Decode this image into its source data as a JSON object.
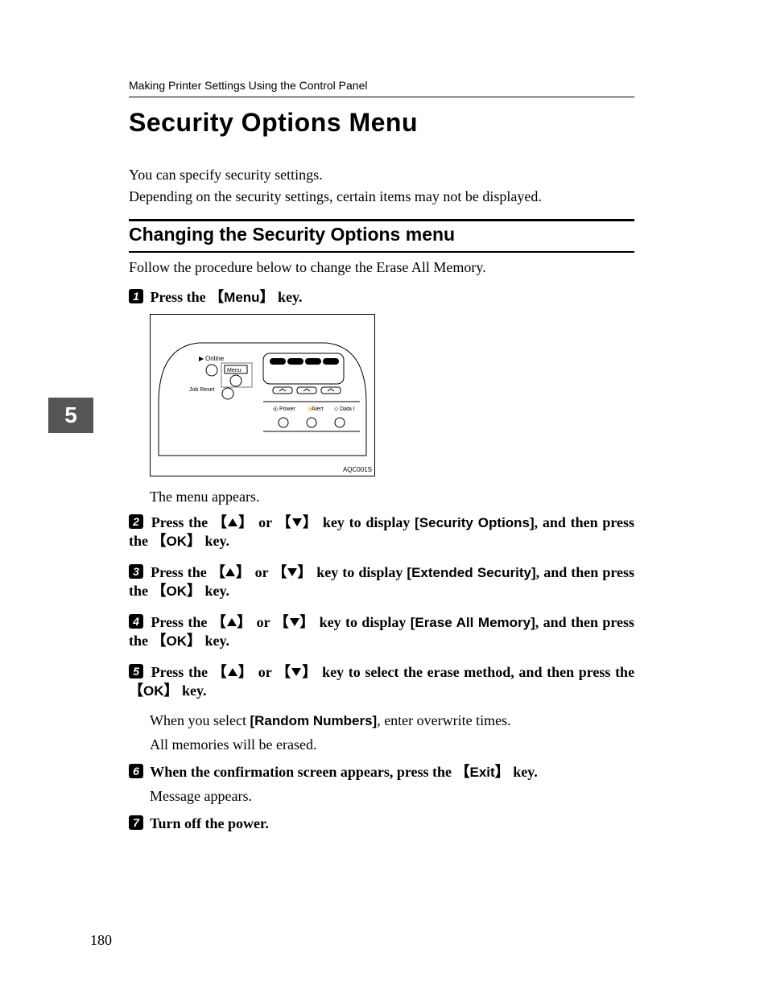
{
  "header": {
    "breadcrumb": "Making Printer Settings Using the Control Panel"
  },
  "title": "Security Options Menu",
  "intro": "You can specify security settings.\nDepending on the security settings, certain items may not be displayed.",
  "section_title": "Changing the Security Options menu",
  "section_intro": "Follow the procedure below to change the Erase All Memory.",
  "chapter_tab": "5",
  "panel_code": "AQC001S",
  "steps": {
    "s1": {
      "num": "1",
      "pre": "Press the ",
      "key": "Menu",
      "post": " key."
    },
    "after_panel": "The menu appears.",
    "s2": {
      "num": "2",
      "pre": "Press the ",
      "mid": " or ",
      "disp": " key to display ",
      "opt": "[Security Options]",
      "tail": ", and then press the ",
      "ok": "OK",
      "tail2": " key."
    },
    "s3": {
      "num": "3",
      "pre": "Press the ",
      "mid": " or ",
      "disp": " key to display ",
      "opt": "[Extended Security]",
      "tail": ", and then press the ",
      "ok": "OK",
      "tail2": " key."
    },
    "s4": {
      "num": "4",
      "pre": "Press the ",
      "mid": " or ",
      "disp": " key to display ",
      "opt": "[Erase All Memory]",
      "tail": ", and then press the ",
      "ok": "OK",
      "tail2": " key."
    },
    "s5": {
      "num": "5",
      "pre": "Press the ",
      "mid": " or ",
      "disp": " key to select the erase method, and then press the ",
      "ok": "OK",
      "tail2": " key.",
      "body1a": "When you select ",
      "body1b": "[Random Numbers]",
      "body1c": ", enter overwrite times.",
      "body2": "All memories will be erased."
    },
    "s6": {
      "num": "6",
      "pre": "When the confirmation screen appears, press the ",
      "key": "Exit",
      "post": " key.",
      "body": "Message appears."
    },
    "s7": {
      "num": "7",
      "text": "Turn off the power."
    }
  },
  "page_number": "180",
  "panel_labels": {
    "online": "Online",
    "menu": "Menu",
    "jobreset": "Job Reset",
    "power": "Power",
    "alert": "Alert",
    "data": "Data I"
  }
}
